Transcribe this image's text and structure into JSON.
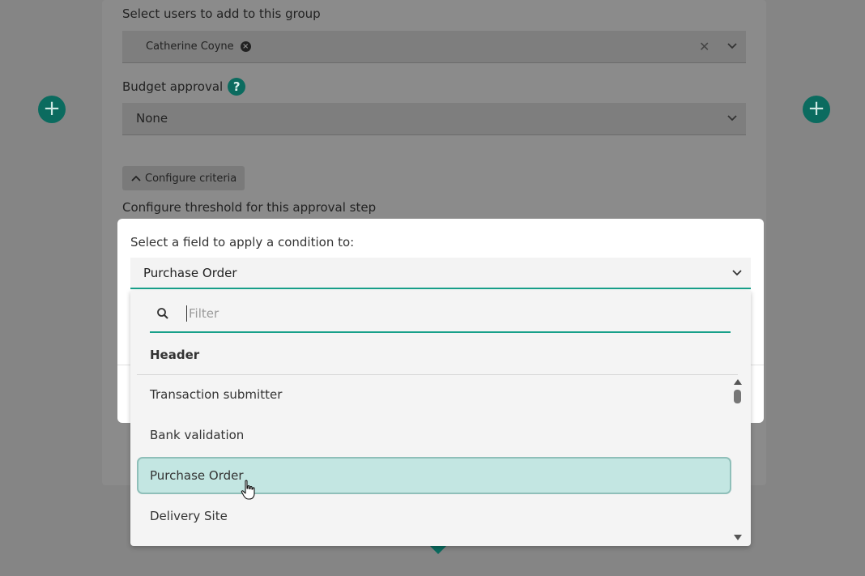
{
  "background_form": {
    "users_label": "Select users to add to this group",
    "selected_user_chip": "Catherine Coyne",
    "clear_symbol": "✕",
    "budget_label": "Budget approval",
    "help_symbol": "?",
    "budget_value": "None",
    "configure_button": "Configure criteria",
    "threshold_label": "Configure threshold for this approval step",
    "add_symbol": "+"
  },
  "modal": {
    "prompt": "Select a field to apply a condition to:",
    "selected_value": "Purchase Order"
  },
  "dropdown": {
    "filter_placeholder": "Filter",
    "group_header": "Header",
    "options": [
      {
        "label": "Transaction submitter",
        "selected": false
      },
      {
        "label": "Bank validation",
        "selected": false
      },
      {
        "label": "Purchase Order",
        "selected": true
      },
      {
        "label": "Delivery Site",
        "selected": false
      }
    ]
  },
  "colors": {
    "accent": "#18a08a",
    "selected_option_bg": "#c3e6e2",
    "add_button": "#0b6b5f"
  },
  "icons": [
    "search-icon",
    "chevron-down-icon",
    "chevron-up-icon",
    "close-icon",
    "help-icon",
    "plus-icon",
    "hand-cursor-icon"
  ]
}
